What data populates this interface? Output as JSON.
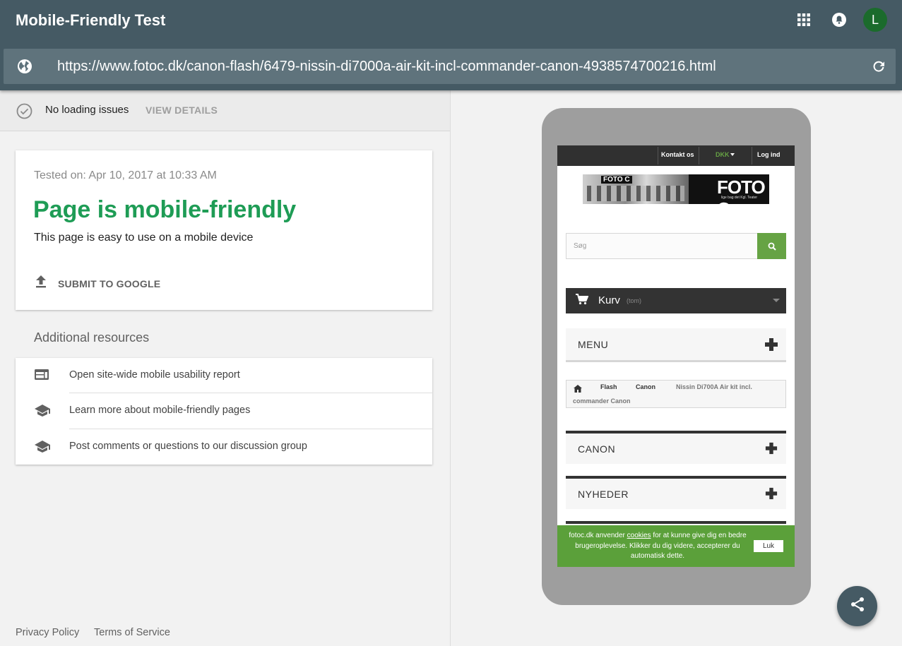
{
  "header": {
    "title": "Mobile-Friendly Test",
    "avatar_letter": "L",
    "url": "https://www.fotoc.dk/canon-flash/6479-nissin-di7000a-air-kit-incl-commander-canon-4938574700216.html"
  },
  "status": {
    "text": "No loading issues",
    "action": "VIEW DETAILS"
  },
  "result": {
    "tested_on": "Tested on: Apr 10, 2017 at 10:33 AM",
    "verdict": "Page is mobile-friendly",
    "subtitle": "This page is easy to use on a mobile device",
    "submit_label": "SUBMIT TO GOOGLE",
    "verdict_color": "#1e9c55"
  },
  "resources": {
    "title": "Additional resources",
    "items": [
      {
        "label": "Open site-wide mobile usability report",
        "icon": "web-report-icon"
      },
      {
        "label": "Learn more about mobile-friendly pages",
        "icon": "school-icon"
      },
      {
        "label": "Post comments or questions to our discussion group",
        "icon": "school-icon"
      }
    ]
  },
  "footer": {
    "privacy": "Privacy Policy",
    "terms": "Terms of Service"
  },
  "preview": {
    "top_links": [
      "Kontakt os",
      "DKK",
      "Log ind"
    ],
    "logo_small": "FOTO C",
    "logo_big": "FOTO C",
    "logo_tag": "lige bag det Kgl. Teater",
    "search_placeholder": "Søg",
    "cart_label": "Kurv",
    "cart_state": "(tom)",
    "menu_label": "MENU",
    "breadcrumb": [
      "Flash",
      "Canon"
    ],
    "breadcrumb_current_1": "Nissin Di700A Air kit incl.",
    "breadcrumb_current_2": "commander Canon",
    "blocks": [
      "CANON",
      "NYHEDER"
    ],
    "cookie_before": "fotoc.dk anvender ",
    "cookie_link": "cookies",
    "cookie_after": " for at kunne give dig en bedre brugeroplevelse. Klikker du dig videre, accepterer du automatisk dette.",
    "cookie_button": "Luk",
    "accent_green": "#66a344",
    "currency_color": "#66a344"
  },
  "colors": {
    "appbar": "#455a64",
    "urlbar": "#5f737c",
    "avatar": "#1b6b2c"
  }
}
